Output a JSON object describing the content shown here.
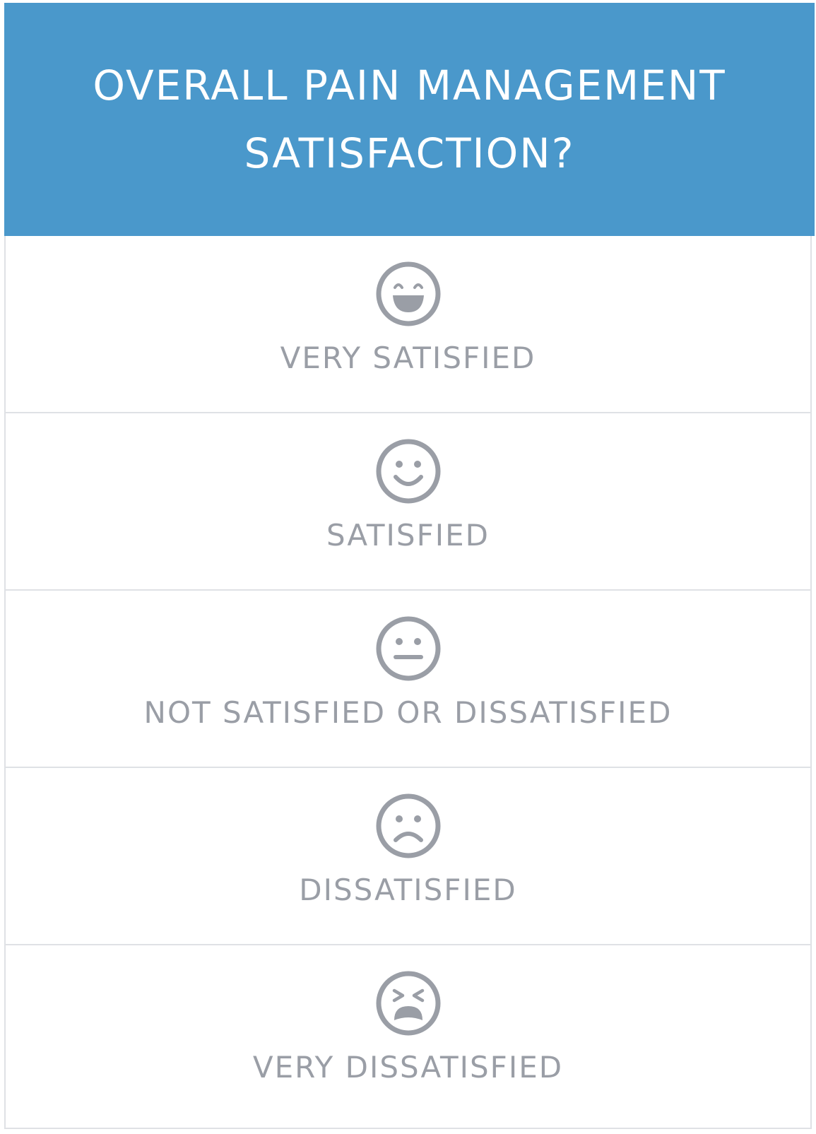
{
  "header": {
    "title_line1": "OVERALL PAIN MANAGEMENT",
    "title_line2": "SATISFACTION?",
    "background_color": "#4a98cb"
  },
  "options": [
    {
      "label": "VERY SATISFIED",
      "icon": "grinning-face-icon"
    },
    {
      "label": "SATISFIED",
      "icon": "smiling-face-icon"
    },
    {
      "label": "NOT SATISFIED OR DISSATISFIED",
      "icon": "neutral-face-icon"
    },
    {
      "label": "DISSATISFIED",
      "icon": "frowning-face-icon"
    },
    {
      "label": "VERY DISSATISFIED",
      "icon": "tired-face-icon"
    }
  ],
  "colors": {
    "icon_and_label": "#9a9ea6",
    "divider": "#dfe1e5"
  }
}
